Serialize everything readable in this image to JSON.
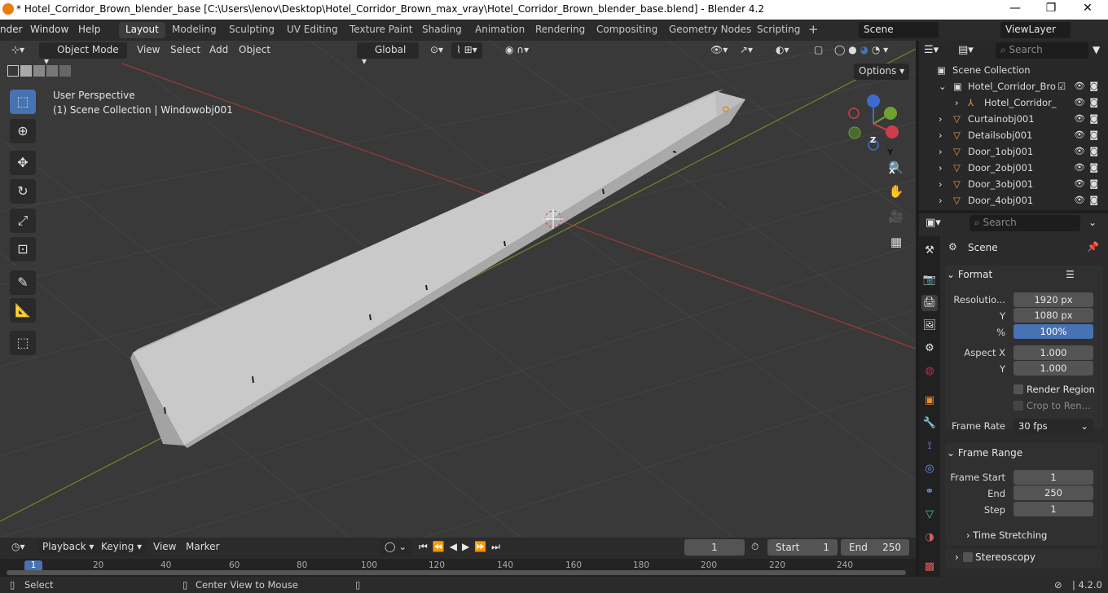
{
  "window": {
    "title": "* Hotel_Corridor_Brown_blender_base [C:\\Users\\lenov\\Desktop\\Hotel_Corridor_Brown_max_vray\\Hotel_Corridor_Brown_blender_base.blend] - Blender 4.2",
    "minimize": "—",
    "maximize": "❐",
    "close": "✕"
  },
  "menubar": {
    "render": "nder",
    "window": "Window",
    "help": "Help"
  },
  "workspaces": [
    "Layout",
    "Modeling",
    "Sculpting",
    "UV Editing",
    "Texture Paint",
    "Shading",
    "Animation",
    "Rendering",
    "Compositing",
    "Geometry Nodes",
    "Scripting"
  ],
  "scene_field": "Scene",
  "viewlayer_field": "ViewLayer",
  "viewport": {
    "mode": "Object Mode",
    "menus": [
      "View",
      "Select",
      "Add",
      "Object"
    ],
    "orientation": "Global",
    "options": "Options",
    "info_line1": "User Perspective",
    "info_line2": "(1) Scene Collection | Windowobj001",
    "gizmo": {
      "z": "Z",
      "y": "Y",
      "x": "X"
    }
  },
  "outliner": {
    "search_placeholder": "Search",
    "root": "Scene Collection",
    "rows": [
      "Hotel_Corridor_Bro",
      "Hotel_Corridor_",
      "Curtainobj001",
      "Detailsobj001",
      "Door_1obj001",
      "Door_2obj001",
      "Door_3obj001",
      "Door_4obj001"
    ]
  },
  "properties": {
    "search_placeholder": "Search",
    "context": "Scene",
    "format_header": "Format",
    "res_x_label": "Resolutio...",
    "res_x": "1920 px",
    "res_y_label": "Y",
    "res_y": "1080 px",
    "pct_label": "%",
    "pct": "100%",
    "aspect_x_label": "Aspect X",
    "aspect_x": "1.000",
    "aspect_y_label": "Y",
    "aspect_y": "1.000",
    "render_region": "Render Region",
    "crop": "Crop to Ren...",
    "frame_rate_label": "Frame Rate",
    "frame_rate": "30 fps",
    "frame_range_header": "Frame Range",
    "frame_start_label": "Frame Start",
    "frame_start": "1",
    "end_label": "End",
    "end": "250",
    "step_label": "Step",
    "step": "1",
    "time_stretching": "Time Stretching",
    "stereoscopy": "Stereoscopy"
  },
  "timeline": {
    "menus": [
      "Playback",
      "Keying",
      "View",
      "Marker"
    ],
    "current_frame": "1",
    "start_label": "Start",
    "start": "1",
    "end_label": "End",
    "end": "250",
    "ticks": [
      "1",
      "20",
      "40",
      "60",
      "80",
      "100",
      "120",
      "140",
      "160",
      "180",
      "200",
      "220",
      "240"
    ]
  },
  "statusbar": {
    "select": "Select",
    "center": "Center View to Mouse",
    "version": "4.2.0"
  },
  "colors": {
    "accent": "#4772b3",
    "viewport_bg": "#393939",
    "panel": "#2b2b2b"
  }
}
